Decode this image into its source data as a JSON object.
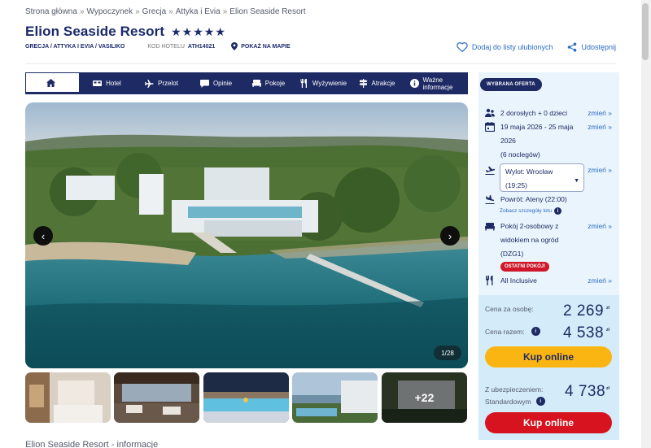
{
  "breadcrumb": [
    "Strona główna",
    "Wypoczynek",
    "Grecja",
    "Attyka i Evia",
    "Elion Seaside Resort"
  ],
  "hotel": {
    "name": "Elion Seaside Resort",
    "stars": "★★★★★",
    "location": "GRECJA / ATTYKA I EVIA / VASILIKO",
    "code_label": "KOD HOTELU",
    "code": "ATH14021",
    "map_label": "POKAŻ NA MAPIE"
  },
  "actions": {
    "favorite": "Dodaj do listy ulubionych",
    "share": "Udostępnij"
  },
  "tabs": [
    "Hotel",
    "Przelot",
    "Opinie",
    "Pokoje",
    "Wyżywienie",
    "Atrakcje",
    "Ważne informacje"
  ],
  "gallery": {
    "counter": "1/28",
    "more": "+22",
    "prev": "‹",
    "next": "›"
  },
  "section_title": "Elion Seaside Resort - informacje",
  "offer": {
    "badge": "WYBRANA OFERTA",
    "change_label": "zmień »",
    "guests": "2 dorosłych + 0 dzieci",
    "dates_line1": "19 maja 2026 - 25 maja",
    "dates_line2": "2026",
    "nights": "(6 noclegów)",
    "departure_line1": "Wylot: Wrocław",
    "departure_line2": "(19:25)",
    "return": "Powrót: Ateny (22:00)",
    "flight_details": "Zobacz szczegóły lotu",
    "room_line1": "Pokój 2-osobowy z",
    "room_line2": "widokiem na ogród",
    "room_line3": "(DZG1)",
    "last_rooms": "OSTATNI POKÓJ!",
    "board": "All Inclusive"
  },
  "prices": {
    "per_person_label": "Cena za osobę:",
    "per_person": "2 269",
    "total_label": "Cena razem:",
    "total": "4 538",
    "currency": "zł",
    "buy_label": "Kup online",
    "insured_label_1": "Z ubezpieczeniem:",
    "insured_label_2": "Standardowym",
    "insured": "4 738",
    "buy_label_2": "Kup online"
  },
  "colors": {
    "navy": "#1d2a64",
    "link": "#2b6cc4",
    "buy_yellow": "#fbb513",
    "buy_red": "#d7131f",
    "panel": "#eaf4fc"
  }
}
